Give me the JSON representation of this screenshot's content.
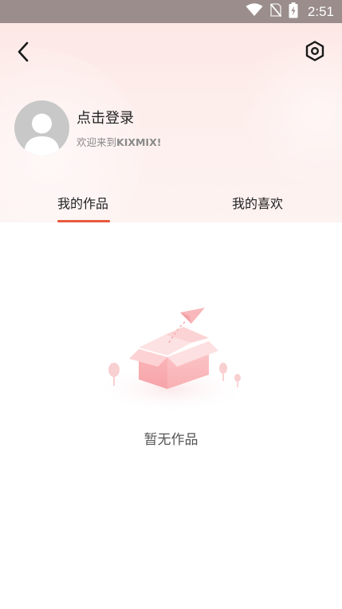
{
  "status_bar": {
    "time": "2:51",
    "icons": [
      "wifi-icon",
      "no-sim-icon",
      "battery-charging-icon"
    ]
  },
  "header": {
    "back_icon": "back-arrow-icon",
    "settings_icon": "settings-hexagon-icon"
  },
  "profile": {
    "login_label": "点击登录",
    "welcome_prefix": "欢迎来到",
    "welcome_brand": "KIXMIX!"
  },
  "tabs": [
    {
      "label": "我的作品",
      "active": true
    },
    {
      "label": "我的喜欢",
      "active": false
    }
  ],
  "empty_state": {
    "message": "暂无作品",
    "illustration": "empty-box-paper-plane"
  },
  "colors": {
    "accent": "#e8593f",
    "status_bar_bg": "#9a8d8c",
    "header_bg": "#fdeeec",
    "box_pink": "#f7a9ad"
  }
}
